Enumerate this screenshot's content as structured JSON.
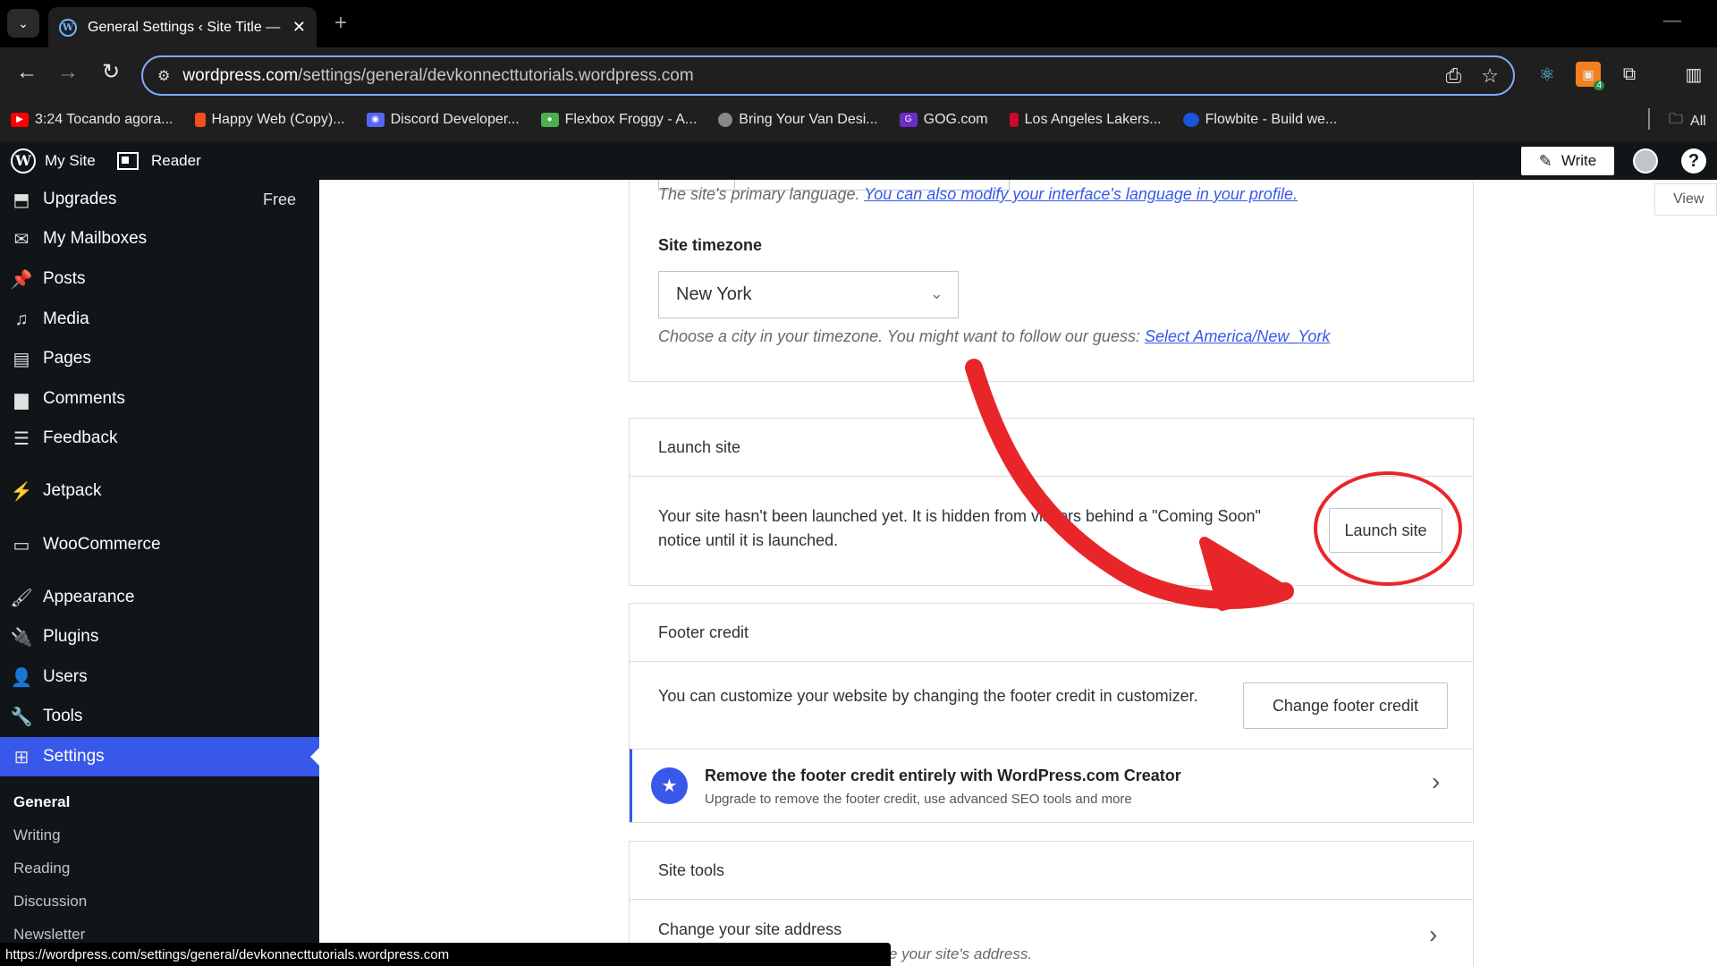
{
  "browser": {
    "tab_title": "General Settings ‹ Site Title — W",
    "url_host": "wordpress.com",
    "url_path": "/settings/general/devkonnecttutorials.wordpress.com",
    "extension_badge": "4",
    "bookmarks": [
      {
        "label": "3:24 Tocando agora...",
        "icon": "youtube-icon",
        "color": "#ff0000"
      },
      {
        "label": "Happy Web (Copy)...",
        "icon": "figma-icon",
        "color": "#f24e1e"
      },
      {
        "label": "Discord Developer...",
        "icon": "discord-icon",
        "color": "#5865f2"
      },
      {
        "label": "Flexbox Froggy - A...",
        "icon": "frog-icon",
        "color": "#4caf50"
      },
      {
        "label": "Bring Your Van Desi...",
        "icon": "globe-icon",
        "color": "#888888"
      },
      {
        "label": "GOG.com",
        "icon": "gog-icon",
        "color": "#6b2ec4"
      },
      {
        "label": "Los Angeles Lakers...",
        "icon": "nba-icon",
        "color": "#c9082a"
      },
      {
        "label": "Flowbite - Build we...",
        "icon": "flowbite-icon",
        "color": "#1a56db"
      }
    ],
    "all_bookmarks_label": "All",
    "status_url": "https://wordpress.com/settings/general/devkonnecttutorials.wordpress.com"
  },
  "adminbar": {
    "my_site": "My Site",
    "reader": "Reader",
    "write": "Write"
  },
  "sidebar": {
    "items": [
      {
        "label": "Upgrades",
        "icon": "upgrades-icon",
        "badge": "Free"
      },
      {
        "label": "My Mailboxes",
        "icon": "mail-icon"
      },
      {
        "label": "Posts",
        "icon": "pin-icon"
      },
      {
        "label": "Media",
        "icon": "media-icon"
      },
      {
        "label": "Pages",
        "icon": "pages-icon"
      },
      {
        "label": "Comments",
        "icon": "comment-icon"
      },
      {
        "label": "Feedback",
        "icon": "feedback-icon"
      },
      {
        "label": "Jetpack",
        "icon": "jetpack-icon"
      },
      {
        "label": "WooCommerce",
        "icon": "woo-icon"
      },
      {
        "label": "Appearance",
        "icon": "brush-icon"
      },
      {
        "label": "Plugins",
        "icon": "plugin-icon"
      },
      {
        "label": "Users",
        "icon": "user-icon"
      },
      {
        "label": "Tools",
        "icon": "wrench-icon"
      },
      {
        "label": "Settings",
        "icon": "settings-icon"
      }
    ],
    "submenu": [
      "General",
      "Writing",
      "Reading",
      "Discussion",
      "Newsletter"
    ]
  },
  "main": {
    "view_label": "View",
    "language_help": "The site's primary language.",
    "language_link": "You can also modify your interface's language in your profile.",
    "timezone_label": "Site timezone",
    "timezone_value": "New York",
    "timezone_help": "Choose a city in your timezone. You might want to follow our guess:",
    "timezone_link": "Select America/New_York",
    "launch": {
      "title": "Launch site",
      "text_line1": "Your site hasn't been launched yet. It is hidden from visitors behind a \"Coming Soon\"",
      "text_line2": "notice until it is launched.",
      "button": "Launch site"
    },
    "footer": {
      "title": "Footer credit",
      "text": "You can customize your website by changing the footer credit in customizer.",
      "button": "Change footer credit",
      "upsell_title": "Remove the footer credit entirely with WordPress.com Creator",
      "upsell_sub": "Upgrade to remove the footer credit, use advanced SEO tools and more"
    },
    "site_tools": {
      "title": "Site tools",
      "change_address": "Change your site address",
      "change_address_sub": "e your site's address."
    }
  },
  "colors": {
    "accent": "#3858e9",
    "annotation": "#e8262a",
    "admin_dark": "#101517"
  }
}
